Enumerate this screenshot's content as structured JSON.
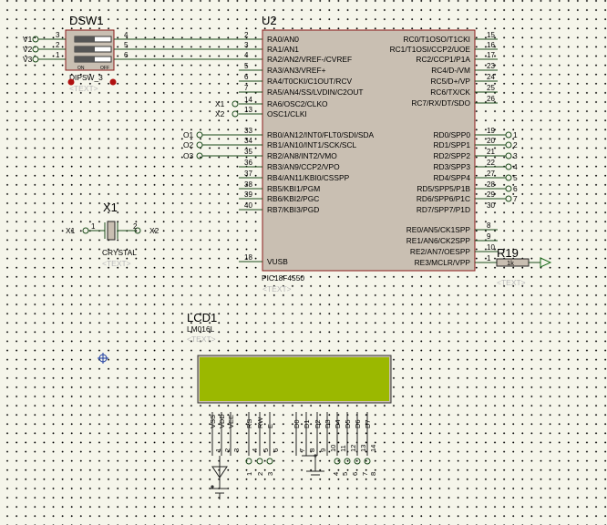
{
  "dsw1": {
    "ref": "DSW1",
    "part": "DIPSW_3",
    "placeholder": "<TEXT>",
    "switch_on": "ON",
    "switch_off": "OFF",
    "nets": [
      "V1",
      "V2",
      "V3"
    ],
    "left_pins": [
      "3",
      "2",
      "1"
    ],
    "right_pins": [
      "4",
      "5",
      "6"
    ]
  },
  "u2": {
    "ref": "U2",
    "part": "PIC18F4550",
    "placeholder": "<TEXT>",
    "left_nums": [
      "2",
      "3",
      "4",
      "5",
      "6",
      "7",
      "14",
      "13",
      "33",
      "34",
      "35",
      "36",
      "37",
      "38",
      "39",
      "40",
      "18"
    ],
    "left_labels": [
      "RA0/AN0",
      "RA1/AN1",
      "RA2/AN2/VREF-/CVREF",
      "RA3/AN3/VREF+",
      "RA4/T0CKI/C1OUT/RCV",
      "RA5/AN4/SS/LVDIN/C2OUT",
      "RA6/OSC2/CLKO",
      "OSC1/CLKI",
      "RB0/AN12/INT0/FLT0/SDI/SDA",
      "RB1/AN10/INT1/SCK/SCL",
      "RB2/AN8/INT2/VMO",
      "RB3/AN9/CCP2/VPO",
      "RB4/AN11/KBI0/CSSPP",
      "RB5/KBI1/PGM",
      "RB6/KBI2/PGC",
      "RB7/KBI3/PGD",
      "VUSB"
    ],
    "right_nums": [
      "15",
      "16",
      "17",
      "23",
      "24",
      "25",
      "26",
      "19",
      "20",
      "21",
      "22",
      "27",
      "28",
      "29",
      "30",
      "8",
      "9",
      "10",
      "1"
    ],
    "right_labels": [
      "RC0/T1OSO/T1CKI",
      "RC1/T1OSI/CCP2/UOE",
      "RC2/CCP1/P1A",
      "RC4/D-/VM",
      "RC5/D+/VP",
      "RC6/TX/CK",
      "RC7/RX/DT/SDO",
      "RD0/SPP0",
      "RD1/SPP1",
      "RD2/SPP2",
      "RD3/SPP3",
      "RD4/SPP4",
      "RD5/SPP5/P1B",
      "RD6/SPP6/P1C",
      "RD7/SPP7/P1D",
      "RE0/AN5/CK1SPP",
      "RE1/AN6/CK2SPP",
      "RE2/AN7/OESPP",
      "RE3/MCLR/VPP"
    ],
    "osc_nets": [
      "X1",
      "X2"
    ],
    "portb_nets": [
      "O1",
      "O2",
      "O3"
    ],
    "portd_nets": [
      "1",
      "2",
      "3",
      "4",
      "5",
      "6",
      "7"
    ]
  },
  "x1": {
    "ref": "X1",
    "part": "CRYSTAL",
    "placeholder": "<TEXT>",
    "pin1": "1",
    "pin2": "2",
    "net_left": "X1",
    "net_right": "X2"
  },
  "r19": {
    "ref": "R19",
    "value": "1k",
    "placeholder": "<TEXT>"
  },
  "lcd1": {
    "ref": "LCD1",
    "part": "LM016L",
    "placeholder": "<TEXT>",
    "display_color": "#9bb800",
    "pin_labels": [
      "VSS",
      "VDD",
      "VEE",
      "RS",
      "RW",
      "E",
      "D0",
      "D1",
      "D2",
      "D3",
      "D4",
      "D5",
      "D6",
      "D7"
    ],
    "pin_nums": [
      "1",
      "2",
      "3",
      "4",
      "5",
      "6",
      "7",
      "8",
      "9",
      "10",
      "11",
      "12",
      "13",
      "14"
    ],
    "bottom_nets_ctrl": [
      "1",
      "2",
      "3"
    ],
    "bottom_nets_data": [
      "4",
      "5",
      "6",
      "7",
      "8"
    ]
  },
  "colors": {
    "component_fill": "#c9bfb2",
    "component_stroke": "#8b1a1a",
    "wire": "#1a4a1a",
    "dip_body": "#c9bfb2"
  }
}
